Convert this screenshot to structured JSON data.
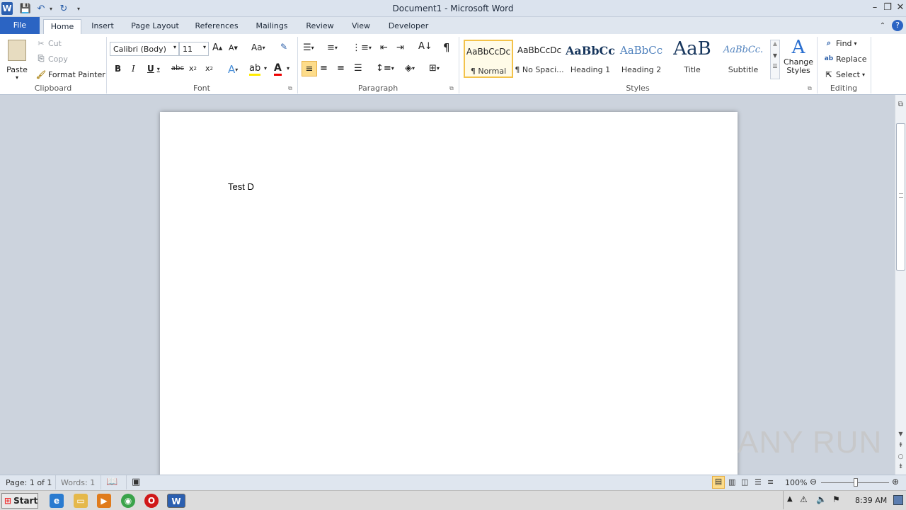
{
  "window": {
    "title": "Document1 - Microsoft Word"
  },
  "tabs": [
    "File",
    "Home",
    "Insert",
    "Page Layout",
    "References",
    "Mailings",
    "Review",
    "View",
    "Developer"
  ],
  "clipboard": {
    "paste": "Paste",
    "cut": "Cut",
    "copy": "Copy",
    "format_painter": "Format Painter",
    "label": "Clipboard"
  },
  "font": {
    "name": "Calibri (Body)",
    "size": "11",
    "label": "Font"
  },
  "paragraph": {
    "label": "Paragraph"
  },
  "styles": {
    "label": "Styles",
    "items": [
      {
        "sample": "AaBbCcDc",
        "name": "¶ Normal"
      },
      {
        "sample": "AaBbCcDc",
        "name": "¶ No Spaci..."
      },
      {
        "sample": "AaBbCc",
        "name": "Heading 1"
      },
      {
        "sample": "AaBbCc",
        "name": "Heading 2"
      },
      {
        "sample": "AaB",
        "name": "Title"
      },
      {
        "sample": "AaBbCc.",
        "name": "Subtitle"
      }
    ],
    "change": "Change Styles"
  },
  "editing": {
    "find": "Find",
    "replace": "Replace",
    "select": "Select",
    "label": "Editing"
  },
  "document": {
    "text": "Test D"
  },
  "status": {
    "page": "Page: 1 of 1",
    "words": "Words: 1",
    "zoom": "100%"
  },
  "taskbar": {
    "start": "Start",
    "time": "8:39 AM"
  },
  "watermark": "ANY RUN"
}
